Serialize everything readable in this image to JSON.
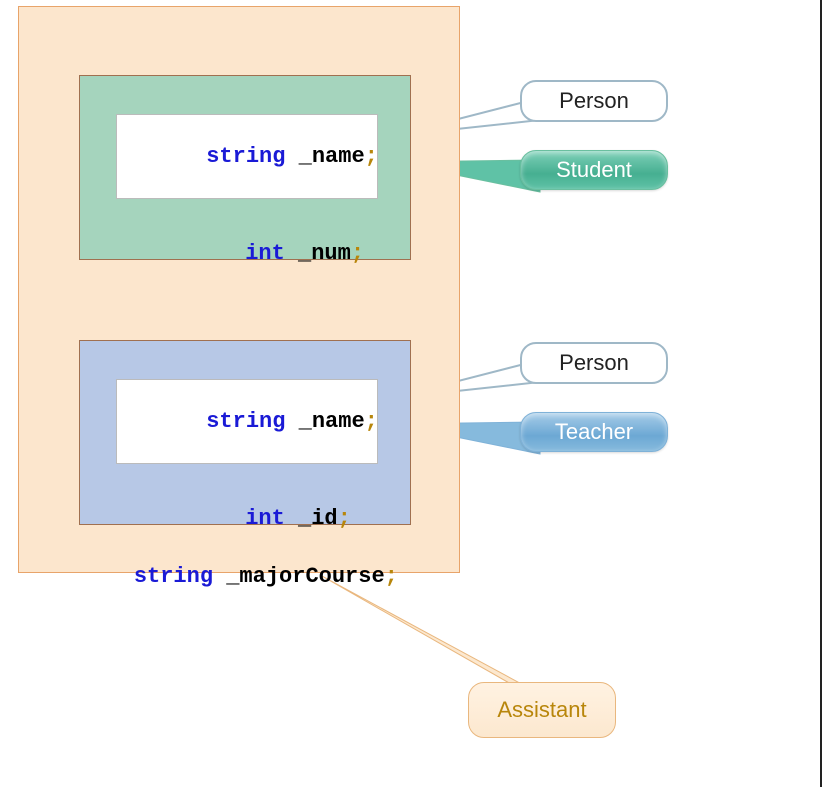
{
  "blocks": {
    "student": {
      "name_row": {
        "kw": "string",
        "id": " _name",
        "sc": ";"
      },
      "field_row": {
        "kw": "int",
        "id": " _num",
        "sc": ";"
      }
    },
    "teacher": {
      "name_row": {
        "kw": "string",
        "id": " _name",
        "sc": ";"
      },
      "field_row": {
        "kw": "int",
        "id": " _id",
        "sc": ";"
      }
    },
    "assistant_row": {
      "kw": "string",
      "id": " _majorCourse",
      "sc": ";"
    }
  },
  "callouts": {
    "person1": "Person",
    "student": "Student",
    "person2": "Person",
    "teacher": "Teacher",
    "assistant": "Assistant"
  },
  "colors": {
    "outer": "#fce6cd",
    "student_bg": "#a5d4bd",
    "teacher_bg": "#b7c8e6"
  }
}
